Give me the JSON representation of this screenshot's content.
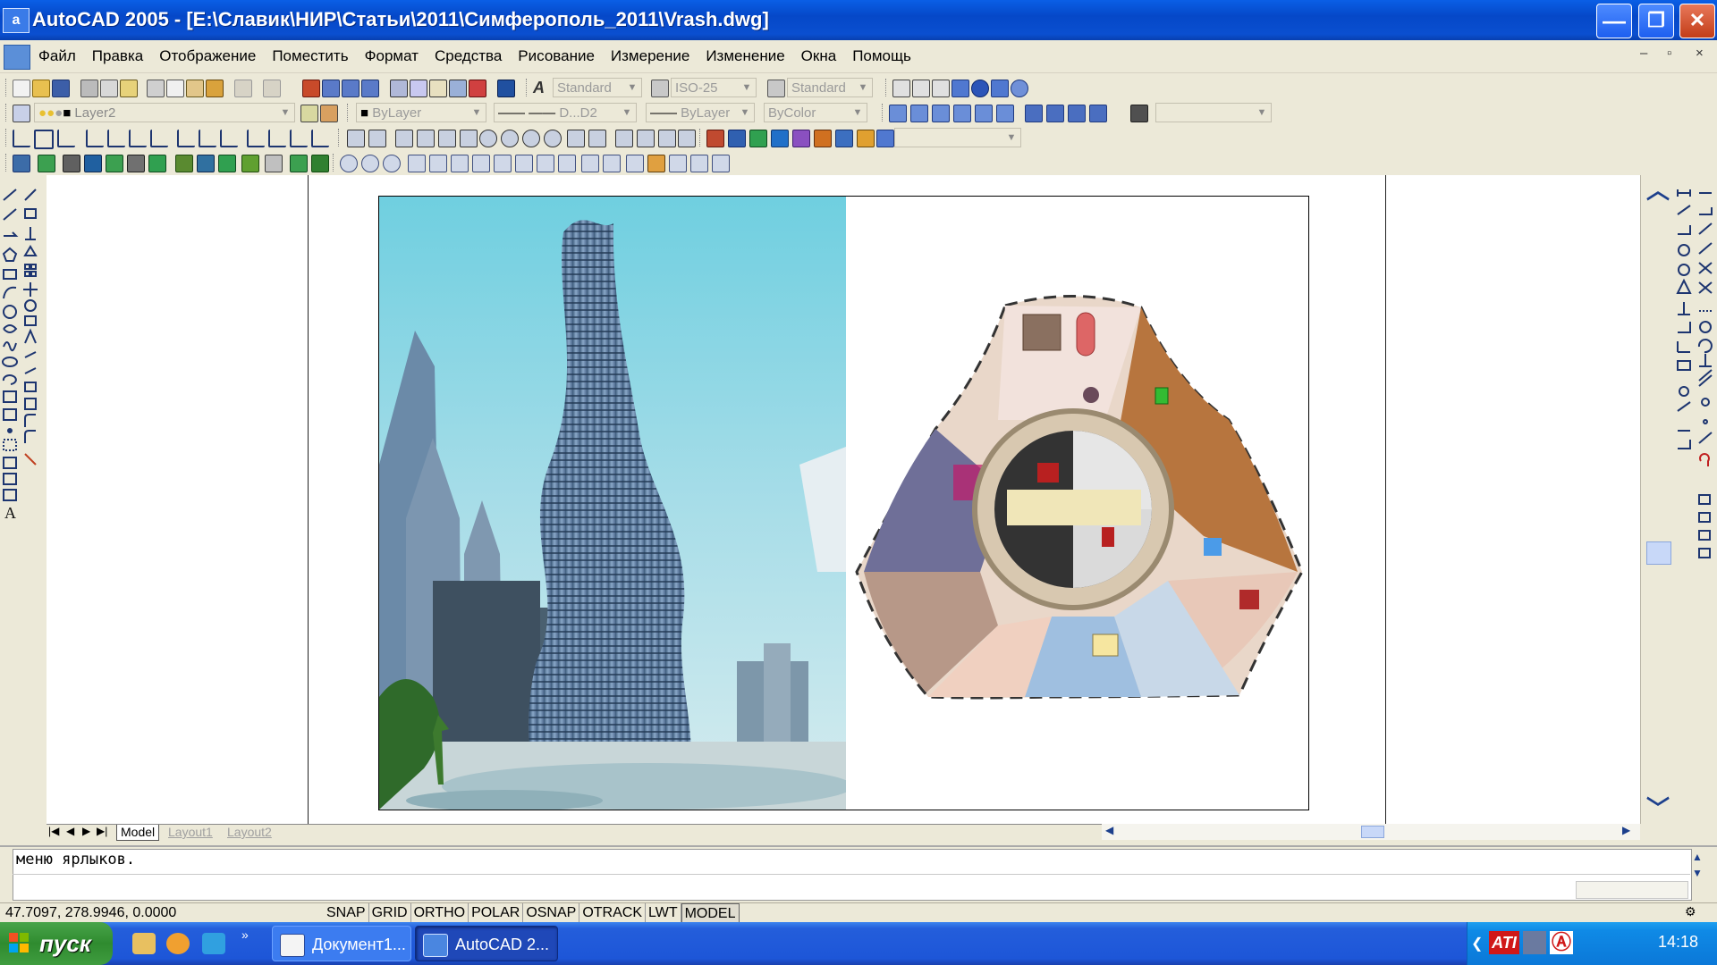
{
  "window": {
    "title": "AutoCAD 2005 - [E:\\Славик\\НИР\\Статьи\\2011\\Симферополь_2011\\Vrash.dwg]",
    "min_glyph": "—",
    "restore_glyph": "❐",
    "close_glyph": "✕"
  },
  "menu": {
    "items": [
      "Файл",
      "Правка",
      "Отображение",
      "Поместить",
      "Формат",
      "Средства",
      "Рисование",
      "Измерение",
      "Изменение",
      "Окна",
      "Помощь"
    ],
    "mdi_min": "–",
    "mdi_restore": "▫",
    "mdi_close": "×"
  },
  "toolbar": {
    "text_style": "Standard",
    "dim_style": "ISO-25",
    "table_style": "Standard",
    "layer": "Layer2",
    "color": "ByLayer",
    "linetype_label": "D...D2",
    "lineweight": "ByLayer",
    "plot_style": "ByColor"
  },
  "tabs": {
    "model": "Model",
    "layout1": "Layout1",
    "layout2": "Layout2"
  },
  "command_line": {
    "text": "меню ярлыков."
  },
  "status": {
    "coords": "47.7097, 278.9946, 0.0000",
    "toggles": [
      "SNAP",
      "GRID",
      "ORTHO",
      "POLAR",
      "OSNAP",
      "OTRACK",
      "LWT",
      "MODEL"
    ]
  },
  "taskbar": {
    "start": "пуск",
    "tasks": [
      "Документ1...",
      "AutoCAD 2..."
    ],
    "tray_labels": [
      "ATI"
    ],
    "clock": "14:18"
  },
  "colors": {
    "titlebar": "#0548c8",
    "taskbar": "#245edb",
    "start_green": "#2f8b2f",
    "sky_top": "#3fb6d2",
    "tower_blue": "#5f7fa3"
  }
}
